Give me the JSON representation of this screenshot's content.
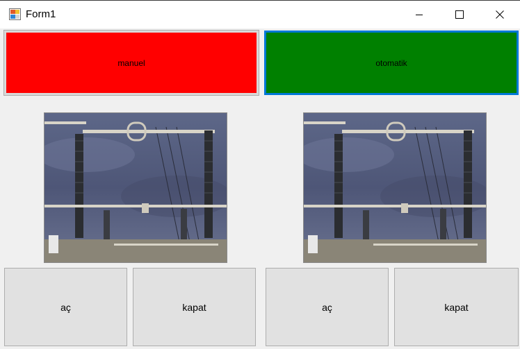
{
  "window": {
    "title": "Form1",
    "icons": {
      "app": "form-icon",
      "minimize": "minimize-icon",
      "maximize": "maximize-icon",
      "close": "close-icon"
    }
  },
  "mode": {
    "manual_label": "manuel",
    "auto_label": "otomatik",
    "manual_color": "#ff0000",
    "auto_color": "#008000"
  },
  "panels": [
    {
      "open_label": "aç",
      "close_label": "kapat"
    },
    {
      "open_label": "aç",
      "close_label": "kapat"
    }
  ]
}
